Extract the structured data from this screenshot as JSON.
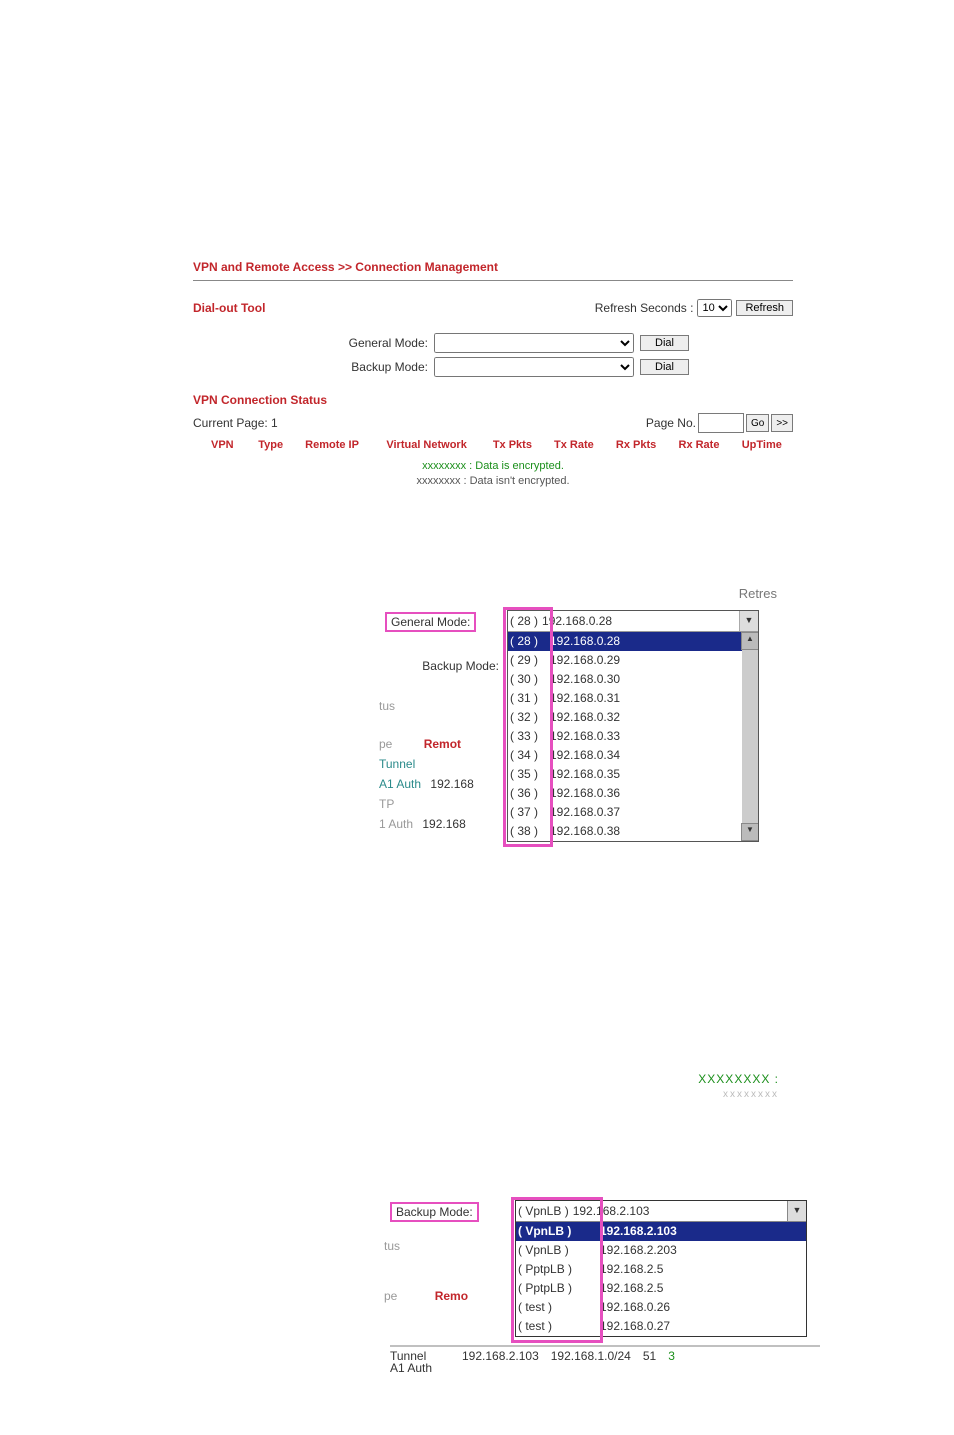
{
  "breadcrumb": "VPN and Remote Access >> Connection Management",
  "dialout": {
    "title": "Dial-out Tool",
    "refresh_label": "Refresh Seconds :",
    "refresh_value": "10",
    "refresh_btn": "Refresh",
    "general_label": "General Mode:",
    "backup_label": "Backup Mode:",
    "dial_btn": "Dial"
  },
  "vcs": {
    "title": "VPN Connection Status",
    "current_page_label": "Current Page: 1",
    "page_no_label": "Page No.",
    "go": "Go",
    "next": ">>",
    "headers": [
      "VPN",
      "Type",
      "Remote IP",
      "Virtual Network",
      "Tx Pkts",
      "Tx Rate",
      "Rx Pkts",
      "Rx Rate",
      "UpTime"
    ]
  },
  "legend": {
    "enc": "xxxxxxxx : Data is encrypted.",
    "noenc": "xxxxxxxx : Data isn't encrypted."
  },
  "mid": {
    "retres_label": "Retres",
    "general_label": "General Mode:",
    "backup_label": "Backup Mode:",
    "selected": {
      "idx": "( 28 )",
      "val": "192.168.0.28"
    },
    "options": [
      {
        "idx": "( 28 )",
        "val": "192.168.0.28",
        "selected": true
      },
      {
        "idx": "( 29 )",
        "val": "192.168.0.29"
      },
      {
        "idx": "( 30 )",
        "val": "192.168.0.30"
      },
      {
        "idx": "( 31 )",
        "val": "192.168.0.31"
      },
      {
        "idx": "( 32 )",
        "val": "192.168.0.32"
      },
      {
        "idx": "( 33 )",
        "val": "192.168.0.33"
      },
      {
        "idx": "( 34 )",
        "val": "192.168.0.34"
      },
      {
        "idx": "( 35 )",
        "val": "192.168.0.35"
      },
      {
        "idx": "( 36 )",
        "val": "192.168.0.36"
      },
      {
        "idx": "( 37 )",
        "val": "192.168.0.37"
      },
      {
        "idx": "( 38 )",
        "val": "192.168.0.38"
      }
    ],
    "left_fragments": {
      "tus": "tus",
      "pe": "pe",
      "remot": "Remot",
      "tunnel": "Tunnel",
      "a1auth": "A1 Auth",
      "tp": "TP",
      "oneauth": "1 Auth",
      "ip1": "192.168",
      "ip2": "192.168"
    },
    "foot_green": "XXXXXXXX :"
  },
  "bot": {
    "backup_label": "Backup Mode:",
    "selected": {
      "name": "( VpnLB )",
      "val": "192.168.2.103"
    },
    "options": [
      {
        "name": "( VpnLB )",
        "val": "192.168.2.103",
        "selected": true
      },
      {
        "name": "( VpnLB )",
        "val": "192.168.2.203"
      },
      {
        "name": "( PptpLB )",
        "val": "192.168.2.5"
      },
      {
        "name": "( PptpLB )",
        "val": "192.168.2.5"
      },
      {
        "name": "( test )",
        "val": "192.168.0.26"
      },
      {
        "name": "( test )",
        "val": "192.168.0.27"
      }
    ],
    "left_fragments": {
      "tus": "tus",
      "pe": "pe",
      "remo": "Remo",
      "tunnel": "Tunnel",
      "a1auth": "A1 Auth"
    },
    "datarow": {
      "ip1": "192.168.2.103",
      "ip2": "192.168.1.0/24",
      "v1": "51",
      "v2": "3"
    }
  }
}
